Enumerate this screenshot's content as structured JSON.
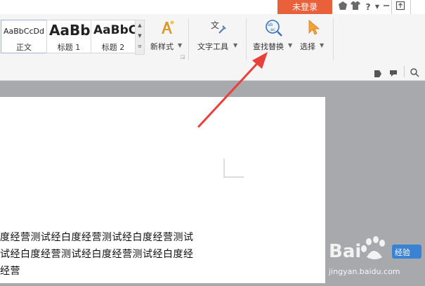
{
  "titlebar": {
    "login_label": "未登录",
    "icons": [
      "skin-icon",
      "shirt-icon",
      "help-icon",
      "minimize-icon",
      "restore-icon"
    ]
  },
  "ribbon": {
    "styles": [
      {
        "sample": "AaBbCcDd",
        "label": "正文"
      },
      {
        "sample": "AaBb",
        "label": "标题 1"
      },
      {
        "sample": "AaBbC",
        "label": "标题 2"
      }
    ],
    "new_style": "新样式",
    "text_tool": "文字工具",
    "find_replace": "查找替换",
    "select": "选择"
  },
  "document": {
    "lines": [
      "度经营测试经白度经营测试经白度经营测试",
      "试经白度经营测试经白度经营测试经白度经",
      "经营"
    ]
  },
  "watermark": {
    "site": "jingyan.baidu.com"
  },
  "colors": {
    "accent": "#e8613a",
    "arrow": "#e8403a"
  }
}
